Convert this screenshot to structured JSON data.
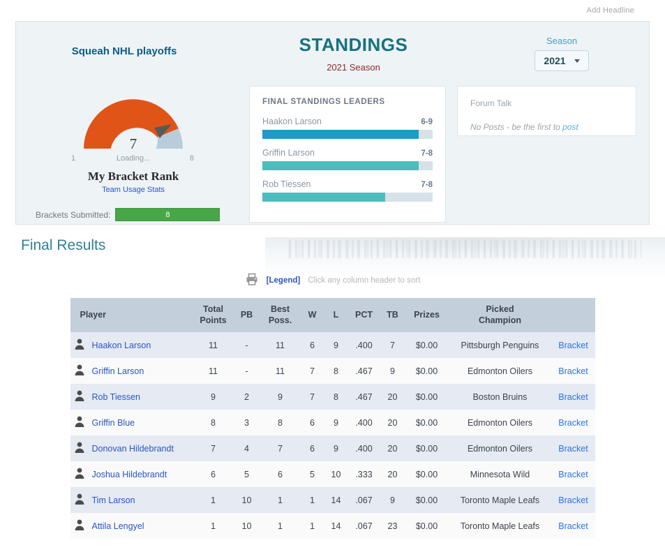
{
  "page": {
    "add_headline": "Add Headline"
  },
  "header": {
    "site_title": "Squeah NHL playoffs",
    "title": "STANDINGS",
    "subtitle": "2021 Season",
    "season_label": "Season",
    "season_value": "2021",
    "colors": {
      "title": "#16737f",
      "subtitle": "#8e2b2b",
      "site_title": "#0b5c86",
      "panel_bg": "#eef3f6"
    }
  },
  "gauge": {
    "value": "7",
    "min_label": "1",
    "max_label": "8",
    "center_label": "Loading...",
    "caption": "My Bracket Rank",
    "team_usage_link": "Team Usage Stats",
    "min": 1,
    "max": 8,
    "arc_color": "#e05517",
    "remainder_color": "#b8ccdb",
    "needle_color": "#595959"
  },
  "brackets_submitted": {
    "label": "Brackets Submitted:",
    "value": "8",
    "bar_color": "#48a548"
  },
  "leaders": {
    "title": "FINAL STANDINGS LEADERS",
    "items": [
      {
        "name": "Haakon Larson",
        "record": "6-9",
        "pct": 92,
        "color": "#1e9ac8"
      },
      {
        "name": "Griffin Larson",
        "record": "7-8",
        "pct": 92,
        "color": "#4cbdbd"
      },
      {
        "name": "Rob Tiessen",
        "record": "7-8",
        "pct": 72,
        "color": "#4cbdbd"
      }
    ],
    "track_color": "#d6e1e8"
  },
  "forum": {
    "title": "Forum Talk",
    "message_prefix": "No Posts - be the first to ",
    "message_link": "post"
  },
  "results": {
    "heading": "Final Results",
    "legend_label": "[Legend]",
    "sort_hint": "Click any column header to sort",
    "printer_icon": "printer-icon",
    "columns": [
      "Player",
      "Total\nPoints",
      "PB",
      "Best\nPoss.",
      "W",
      "L",
      "PCT",
      "TB",
      "Prizes",
      "Picked\nChampion",
      ""
    ],
    "rows": [
      {
        "player": "Haakon Larson",
        "total_points": "11",
        "pb": "-",
        "best_poss": "11",
        "w": "6",
        "l": "9",
        "pct": ".400",
        "tb": "7",
        "prizes": "$0.00",
        "champion": "Pittsburgh Penguins",
        "bracket": "Bracket"
      },
      {
        "player": "Griffin Larson",
        "total_points": "11",
        "pb": "-",
        "best_poss": "11",
        "w": "7",
        "l": "8",
        "pct": ".467",
        "tb": "9",
        "prizes": "$0.00",
        "champion": "Edmonton Oilers",
        "bracket": "Bracket"
      },
      {
        "player": "Rob Tiessen",
        "total_points": "9",
        "pb": "2",
        "best_poss": "9",
        "w": "7",
        "l": "8",
        "pct": ".467",
        "tb": "20",
        "prizes": "$0.00",
        "champion": "Boston Bruins",
        "bracket": "Bracket"
      },
      {
        "player": "Griffin Blue",
        "total_points": "8",
        "pb": "3",
        "best_poss": "8",
        "w": "6",
        "l": "9",
        "pct": ".400",
        "tb": "20",
        "prizes": "$0.00",
        "champion": "Edmonton Oilers",
        "bracket": "Bracket"
      },
      {
        "player": "Donovan Hildebrandt",
        "total_points": "7",
        "pb": "4",
        "best_poss": "7",
        "w": "6",
        "l": "9",
        "pct": ".400",
        "tb": "20",
        "prizes": "$0.00",
        "champion": "Edmonton Oilers",
        "bracket": "Bracket"
      },
      {
        "player": "Joshua Hildebrandt",
        "total_points": "6",
        "pb": "5",
        "best_poss": "6",
        "w": "5",
        "l": "10",
        "pct": ".333",
        "tb": "20",
        "prizes": "$0.00",
        "champion": "Minnesota Wild",
        "bracket": "Bracket"
      },
      {
        "player": "Tim Larson",
        "total_points": "1",
        "pb": "10",
        "best_poss": "1",
        "w": "1",
        "l": "14",
        "pct": ".067",
        "tb": "9",
        "prizes": "$0.00",
        "champion": "Toronto Maple Leafs",
        "bracket": "Bracket"
      },
      {
        "player": "Attila Lengyel",
        "total_points": "1",
        "pb": "10",
        "best_poss": "1",
        "w": "1",
        "l": "14",
        "pct": ".067",
        "tb": "23",
        "prizes": "$0.00",
        "champion": "Toronto Maple Leafs",
        "bracket": "Bracket"
      }
    ]
  }
}
